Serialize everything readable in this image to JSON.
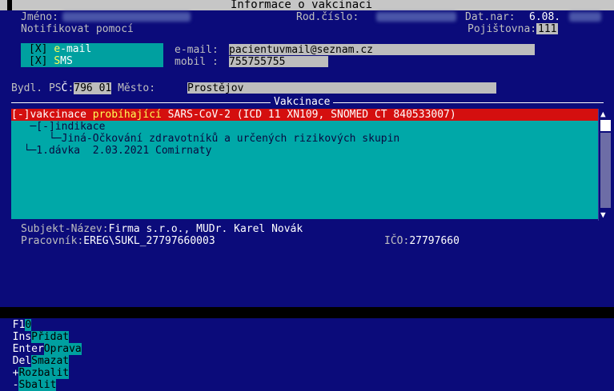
{
  "window": {
    "title": "Informace o vakcinaci"
  },
  "patient": {
    "jmeno_label": "Jméno:",
    "rodcislo_label": "Rod.číslo:",
    "datnar_label": "Dat.nar:",
    "datnar_value": "6.08.",
    "pojistovna_label": "Pojištovna:",
    "pojistovna_value": "111"
  },
  "notify": {
    "label": "Notifikovat pomocí",
    "email_check": "[X]",
    "email_hot": "e",
    "email_rest": "-mail",
    "sms_check": "[X]",
    "sms_hot": "S",
    "sms_rest": "MS",
    "email_field_label": "e-mail:",
    "email_value": "pacientuvmail@seznam.cz",
    "mobil_label": "mobil :",
    "mobil_value": "755755755"
  },
  "address": {
    "bydl_label": "Bydl. PS",
    "bydl_hot": "Č",
    "bydl_colon": ":",
    "psc_value": "796 01",
    "mesto_label": " Město:",
    "mesto_value": "Prostějov"
  },
  "vakcinace": {
    "section_title": "Vakcinace",
    "rows": [
      "[-]vakcinace probíhající SARS-CoV-2 (ICD 11 XN109, SNOMED CT 840533007)",
      "   ─[-]indikace",
      "      └─Jiná-Očkování zdravotníků a určených rizikových skupin",
      "  └─1.dávka  2.03.2021 Comirnaty"
    ]
  },
  "subjekt": {
    "nazev_label": "Subjekt-Název:",
    "nazev_value": "Firma s.r.o., MUDr. Karel Novák",
    "pracovnik_label": "Pracovník:",
    "pracovnik_value": "EREG\\SUKL_27797660003",
    "ico_label": "IČO:",
    "ico_value": "27797660"
  },
  "fkeys": [
    {
      "key": "F1",
      "hot": "0",
      "label": ""
    },
    {
      "key": "Ins",
      "label": "Přidat"
    },
    {
      "key": "Enter",
      "label": "Oprava"
    },
    {
      "key": "Del",
      "label": "Smazat"
    },
    {
      "key": "+",
      "label": "Rozbalit"
    },
    {
      "key": "-",
      "label": "Sbalit"
    }
  ],
  "colors": {
    "background": "#0b0b7a",
    "title": "#c6c6c6",
    "tree": "#00a8a8",
    "selected_row": "#d40f0f",
    "hotkey": "#ffff55"
  }
}
